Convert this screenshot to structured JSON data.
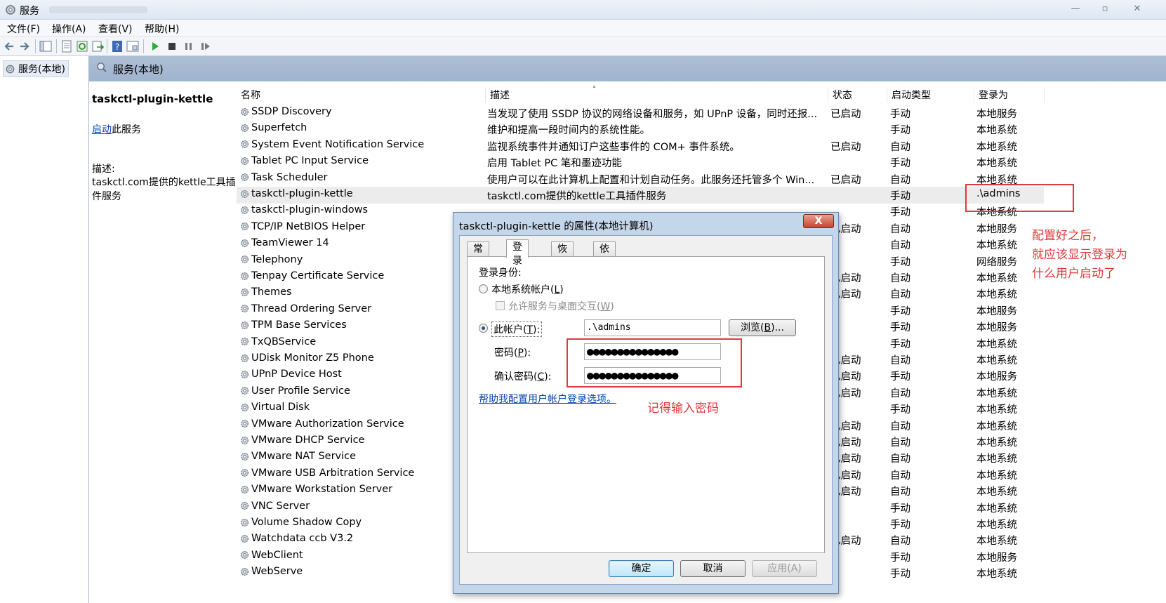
{
  "window": {
    "title": "服务"
  },
  "menu": [
    "文件(F)",
    "操作(A)",
    "查看(V)",
    "帮助(H)"
  ],
  "tree": {
    "root_label": "服务(本地)"
  },
  "pane": {
    "header": "服务(本地)"
  },
  "ext": {
    "service_name": "taskctl-plugin-kettle",
    "start_link": "启动",
    "start_suffix": "此服务",
    "desc_label": "描述:",
    "desc_text": "taskctl.com提供的kettle工具插件服务"
  },
  "grid": {
    "columns": [
      "名称",
      "描述",
      "状态",
      "启动类型",
      "登录为"
    ],
    "rows": [
      {
        "name": "SSDP Discovery",
        "desc": "当发现了使用 SSDP 协议的网络设备和服务，如 UPnP 设备，同时还报...",
        "status": "已启动",
        "start": "手动",
        "logon": "本地服务"
      },
      {
        "name": "Superfetch",
        "desc": "维护和提高一段时间内的系统性能。",
        "status": "",
        "start": "手动",
        "logon": "本地系统"
      },
      {
        "name": "System Event Notification Service",
        "desc": "监视系统事件并通知订户这些事件的 COM+ 事件系统。",
        "status": "已启动",
        "start": "自动",
        "logon": "本地系统"
      },
      {
        "name": "Tablet PC Input Service",
        "desc": "启用 Tablet PC 笔和墨迹功能",
        "status": "",
        "start": "手动",
        "logon": "本地系统"
      },
      {
        "name": "Task Scheduler",
        "desc": "使用户可以在此计算机上配置和计划自动任务。此服务还托管多个 Win...",
        "status": "已启动",
        "start": "自动",
        "logon": "本地系统"
      },
      {
        "name": "taskctl-plugin-kettle",
        "desc": "taskctl.com提供的kettle工具插件服务",
        "status": "",
        "start": "手动",
        "logon": ".\\admins",
        "selected": true
      },
      {
        "name": "taskctl-plugin-windows",
        "desc": "",
        "status": "",
        "start": "手动",
        "logon": "本地系统"
      },
      {
        "name": "TCP/IP NetBIOS Helper",
        "desc": "",
        "status": "已启动",
        "start": "自动",
        "logon": "本地服务"
      },
      {
        "name": "TeamViewer 14",
        "desc": "",
        "status": "",
        "start": "自动",
        "logon": "本地系统"
      },
      {
        "name": "Telephony",
        "desc": "",
        "status": "",
        "start": "手动",
        "logon": "网络服务"
      },
      {
        "name": "Tenpay Certificate Service",
        "desc": "",
        "status": "已启动",
        "start": "自动",
        "logon": "本地系统"
      },
      {
        "name": "Themes",
        "desc": "",
        "status": "已启动",
        "start": "自动",
        "logon": "本地系统"
      },
      {
        "name": "Thread Ordering Server",
        "desc": "",
        "status": "",
        "start": "手动",
        "logon": "本地服务"
      },
      {
        "name": "TPM Base Services",
        "desc": "",
        "status": "",
        "start": "手动",
        "logon": "本地服务"
      },
      {
        "name": "TxQBService",
        "desc": "",
        "status": "",
        "start": "手动",
        "logon": "本地系统"
      },
      {
        "name": "UDisk Monitor Z5 Phone",
        "desc": "",
        "status": "已启动",
        "start": "自动",
        "logon": "本地系统"
      },
      {
        "name": "UPnP Device Host",
        "desc": "",
        "status": "已启动",
        "start": "手动",
        "logon": "本地服务"
      },
      {
        "name": "User Profile Service",
        "desc": "",
        "status": "已启动",
        "start": "自动",
        "logon": "本地系统"
      },
      {
        "name": "Virtual Disk",
        "desc": "",
        "status": "",
        "start": "手动",
        "logon": "本地系统"
      },
      {
        "name": "VMware Authorization Service",
        "desc": "",
        "status": "已启动",
        "start": "自动",
        "logon": "本地系统"
      },
      {
        "name": "VMware DHCP Service",
        "desc": "",
        "status": "已启动",
        "start": "自动",
        "logon": "本地系统"
      },
      {
        "name": "VMware NAT Service",
        "desc": "",
        "status": "已启动",
        "start": "自动",
        "logon": "本地系统"
      },
      {
        "name": "VMware USB Arbitration Service",
        "desc": "",
        "status": "已启动",
        "start": "自动",
        "logon": "本地系统"
      },
      {
        "name": "VMware Workstation Server",
        "desc": "",
        "status": "已启动",
        "start": "自动",
        "logon": "本地系统"
      },
      {
        "name": "VNC Server",
        "desc": "",
        "status": "",
        "start": "手动",
        "logon": "本地系统"
      },
      {
        "name": "Volume Shadow Copy",
        "desc": "",
        "status": "",
        "start": "手动",
        "logon": "本地系统"
      },
      {
        "name": "Watchdata ccb V3.2",
        "desc": "",
        "status": "已启动",
        "start": "自动",
        "logon": "本地系统"
      },
      {
        "name": "WebClient",
        "desc": "",
        "status": "",
        "start": "手动",
        "logon": "本地服务"
      },
      {
        "name": "WebServe",
        "desc": "",
        "status": "",
        "start": "手动",
        "logon": "本地系统"
      }
    ]
  },
  "annotations": {
    "right_note": [
      "配置好之后，",
      "就应该显示登录为",
      "什么用户启动了"
    ],
    "pwd_note": "记得输入密码"
  },
  "dialog": {
    "title": "taskctl-plugin-kettle 的属性(本地计算机)",
    "close": "X",
    "tabs": [
      "常规",
      "登录",
      "恢复",
      "依存关系"
    ],
    "logon_as_label": "登录身份:",
    "local_system_label": "本地系统帐户(",
    "local_system_key": "L",
    "interact_label": "允许服务与桌面交互(",
    "interact_key": "W",
    "this_account_label": "此帐户(",
    "this_account_key": "T",
    "account_value": ".\\admins",
    "browse_label": "浏览(",
    "browse_key": "B",
    "browse_suffix": ")...",
    "password_label": "密码(",
    "password_key": "P",
    "confirm_label": "确认密码(",
    "confirm_key": "C",
    "password_mask": "●●●●●●●●●●●●●●●",
    "confirm_mask": "●●●●●●●●●●●●●●●",
    "help_link": "帮助我配置用户帐户登录选项。",
    "ok": "确定",
    "cancel": "取消",
    "apply": "应用(A)"
  },
  "colors": {
    "accent_red": "#e0393b",
    "link": "#0645ad"
  }
}
